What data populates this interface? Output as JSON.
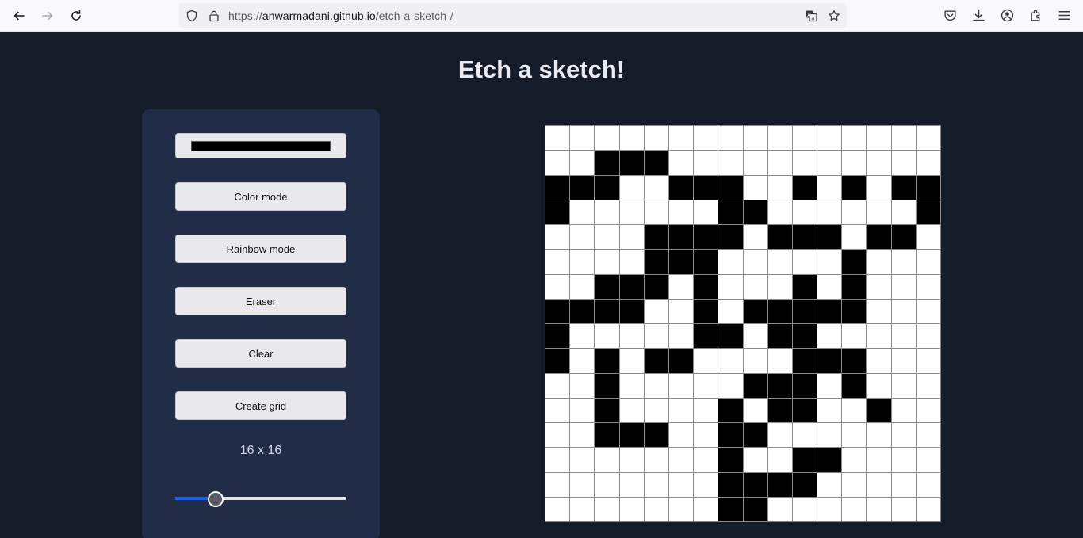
{
  "browser": {
    "url_prefix": "https://",
    "url_host": "anwarmadani.github.io",
    "url_path": "/etch-a-sketch-/",
    "icons": [
      "back-icon",
      "forward-icon",
      "reload-icon",
      "shield-icon",
      "lock-icon",
      "translate-icon",
      "star-icon",
      "pocket-icon",
      "download-icon",
      "account-icon",
      "extensions-icon",
      "menu-icon"
    ]
  },
  "page": {
    "title": "Etch a sketch!"
  },
  "controls": {
    "color_value": "#000000",
    "buttons": [
      "Color mode",
      "Rainbow mode",
      "Eraser",
      "Clear",
      "Create grid"
    ],
    "size_label": "16 x 16",
    "slider": {
      "min": 1,
      "max": 64,
      "value": 16
    }
  },
  "colors": {
    "background": "#141b29",
    "panel": "#212c47",
    "accent": "#1c62e8",
    "cell_on": "#000000",
    "cell_off": "#ffffff"
  },
  "grid": {
    "size": 16,
    "rows": [
      "0000000000000000",
      "0011100000000000",
      "1110011100101011",
      "1000000110000001",
      "0000111101110110",
      "0000111000001000",
      "0011101000101000",
      "1111001011111000",
      "1000001101100000",
      "1010110000111000",
      "0010000011101000",
      "0010000101100100",
      "0011100110000000",
      "0000000100110000",
      "0000000111100000",
      "0000000110000000"
    ]
  }
}
